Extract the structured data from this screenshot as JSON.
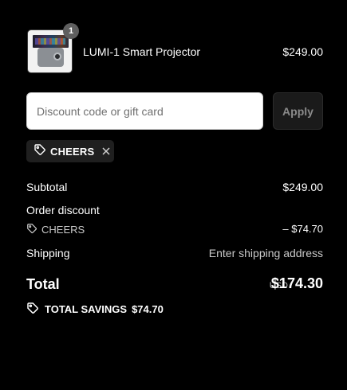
{
  "product": {
    "name": "LUMI-1 Smart Projector",
    "price": "$249.00",
    "quantity": "1",
    "image_icon": "projector-image"
  },
  "discount_form": {
    "placeholder": "Discount code or gift card",
    "value": "",
    "apply_label": "Apply"
  },
  "applied_code": {
    "label": "CHEERS",
    "icon": "tag-icon",
    "remove_icon": "close-icon"
  },
  "summary": {
    "subtotal_label": "Subtotal",
    "subtotal_value": "$249.00",
    "order_discount_label": "Order discount",
    "discount_code": "CHEERS",
    "discount_value": "– $74.70",
    "shipping_label": "Shipping",
    "shipping_value": "Enter shipping address",
    "total_label": "Total",
    "currency": "USD",
    "total_value": "$174.30",
    "savings_label": "TOTAL SAVINGS",
    "savings_value": "$74.70"
  },
  "colors": {
    "background": "#000000",
    "input_bg": "#ffffff",
    "chip_bg": "#1f1f1f",
    "apply_bg": "#1a1a1a",
    "badge_bg": "#5f5f5f"
  }
}
